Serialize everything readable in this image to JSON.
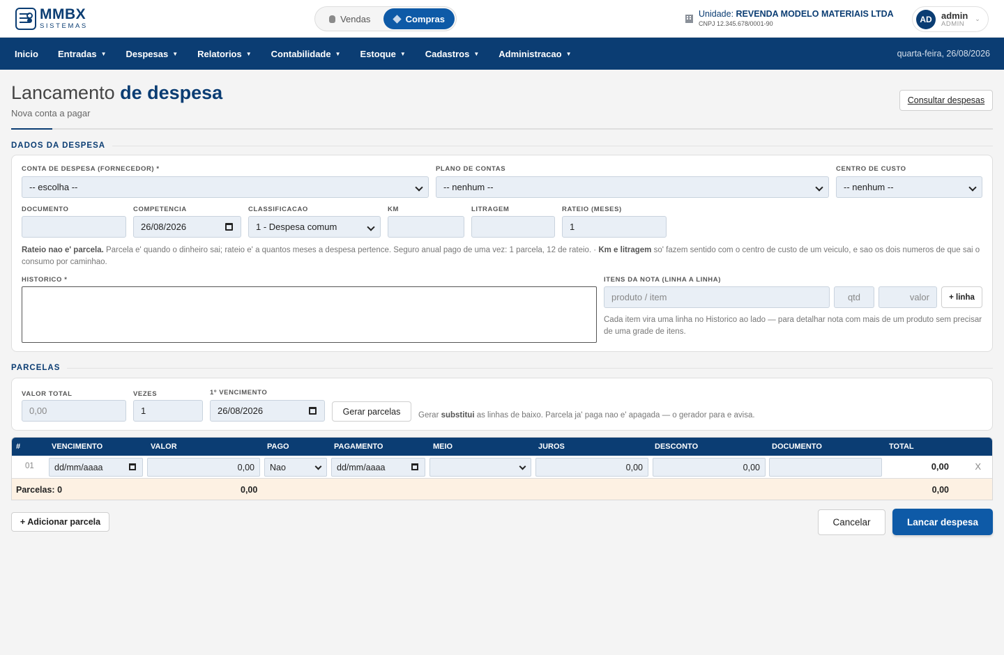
{
  "brand": {
    "name": "MMBX",
    "tagline": "SISTEMAS"
  },
  "mode": {
    "vendas": "Vendas",
    "compras": "Compras"
  },
  "unit": {
    "label": "Unidade:",
    "name": "REVENDA MODELO MATERIAIS LTDA",
    "cnpj": "CNPJ 12.345.678/0001-90"
  },
  "user": {
    "initials": "AD",
    "name": "admin",
    "role": "ADMIN"
  },
  "nav": {
    "items": [
      "Inicio",
      "Entradas",
      "Despesas",
      "Relatorios",
      "Contabilidade",
      "Estoque",
      "Cadastros",
      "Administracao"
    ],
    "date": "quarta-feira, 26/08/2026"
  },
  "page": {
    "title_light": "Lancamento",
    "title_bold": "de despesa",
    "subtitle": "Nova conta a pagar",
    "consultar": "Consultar despesas"
  },
  "dados": {
    "section": "DADOS DA DESPESA",
    "conta_label": "CONTA DE DESPESA (FORNECEDOR) *",
    "conta_value": "-- escolha --",
    "plano_label": "PLANO DE CONTAS",
    "plano_value": "-- nenhum --",
    "centro_label": "CENTRO DE CUSTO",
    "centro_value": "-- nenhum --",
    "documento_label": "DOCUMENTO",
    "documento_value": "",
    "competencia_label": "COMPETENCIA",
    "competencia_value": "26/08/2026",
    "classificacao_label": "CLASSIFICACAO",
    "classificacao_value": "1 - Despesa comum",
    "km_label": "KM",
    "litragem_label": "LITRAGEM",
    "rateio_label": "RATEIO (MESES)",
    "rateio_value": "1",
    "help_b1": "Rateio nao e' parcela.",
    "help_t1": " Parcela e' quando o dinheiro sai; rateio e' a quantos meses a despesa pertence. Seguro anual pago de uma vez: 1 parcela, 12 de rateio. · ",
    "help_b2": "Km e litragem",
    "help_t2": " so' fazem sentido com o centro de custo de um veiculo, e sao os dois numeros de que sai o consumo por caminhao.",
    "historico_label": "HISTORICO *",
    "itens_label": "ITENS DA NOTA (LINHA A LINHA)",
    "item_ph": "produto / item",
    "qtd_ph": "qtd",
    "valor_ph": "valor",
    "add_linha": "+ linha",
    "itens_help": "Cada item vira uma linha no Historico ao lado — para detalhar nota com mais de um produto sem precisar de uma grade de itens."
  },
  "parcelas": {
    "section": "PARCELAS",
    "valor_total_label": "VALOR TOTAL",
    "valor_total_ph": "0,00",
    "vezes_label": "VEZES",
    "vezes_value": "1",
    "venc_label": "1º VENCIMENTO",
    "venc_value": "26/08/2026",
    "gerar": "Gerar parcelas",
    "help_t1": "Gerar ",
    "help_b": "substitui",
    "help_t2": " as linhas de baixo. Parcela ja' paga nao e' apagada — o gerador para e avisa."
  },
  "table": {
    "headers": [
      "#",
      "VENCIMENTO",
      "VALOR",
      "PAGO",
      "PAGAMENTO",
      "MEIO",
      "JUROS",
      "DESCONTO",
      "DOCUMENTO",
      "TOTAL"
    ],
    "rows": [
      {
        "num": "01",
        "vencimento": "dd/mm/aaaa",
        "valor": "0,00",
        "pago": "Nao",
        "pagamento": "dd/mm/aaaa",
        "meio": "",
        "juros": "0,00",
        "desconto": "0,00",
        "documento": "",
        "total": "0,00",
        "remove": "X"
      }
    ],
    "footer": {
      "count_label": "Parcelas: 0",
      "valor_sum": "0,00",
      "total_sum": "0,00"
    }
  },
  "actions": {
    "add": "+ Adicionar parcela",
    "cancel": "Cancelar",
    "submit": "Lancar despesa"
  }
}
